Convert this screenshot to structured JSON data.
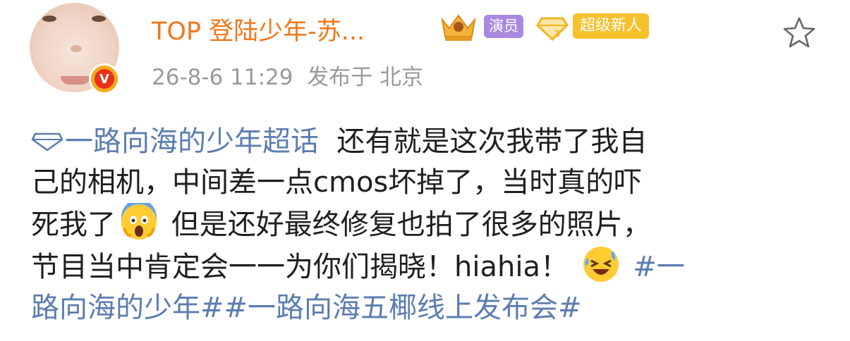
{
  "post": {
    "username": "TOP 登陆少年-苏...",
    "role_badge": "演员",
    "level_badge": "超级新人",
    "timestamp": "26-8-6 11:29",
    "published_at": "发布于 北京",
    "topic": "一路向海的少年超话",
    "text_line1_rest": "  还有就是这次我带了我自",
    "text_line2": "己的相机，中间差一点cmos坏掉了，当时真的吓",
    "text_line3_a": "死我了",
    "text_line3_b": " 但是还好最终修复也拍了很多的照片，",
    "text_line4_a": "节目当中肯定会一一为你们揭晓！hiahia！",
    "hashtag_part1": "#一",
    "hashtag_part2": "路向海的少年##一路向海五椰线上发布会#",
    "icons": [
      "verified-badge-icon",
      "crown-icon",
      "gem-level-icon",
      "star-icon",
      "topic-diamond-icon",
      "scream-emoji-icon",
      "laugh-tears-emoji-icon"
    ],
    "colors": {
      "username": "#f1761a",
      "role_badge": "#a98ae0",
      "level_badge": "#f6c12b",
      "topic": "#5b7db0",
      "meta": "#9a9a9a"
    }
  }
}
